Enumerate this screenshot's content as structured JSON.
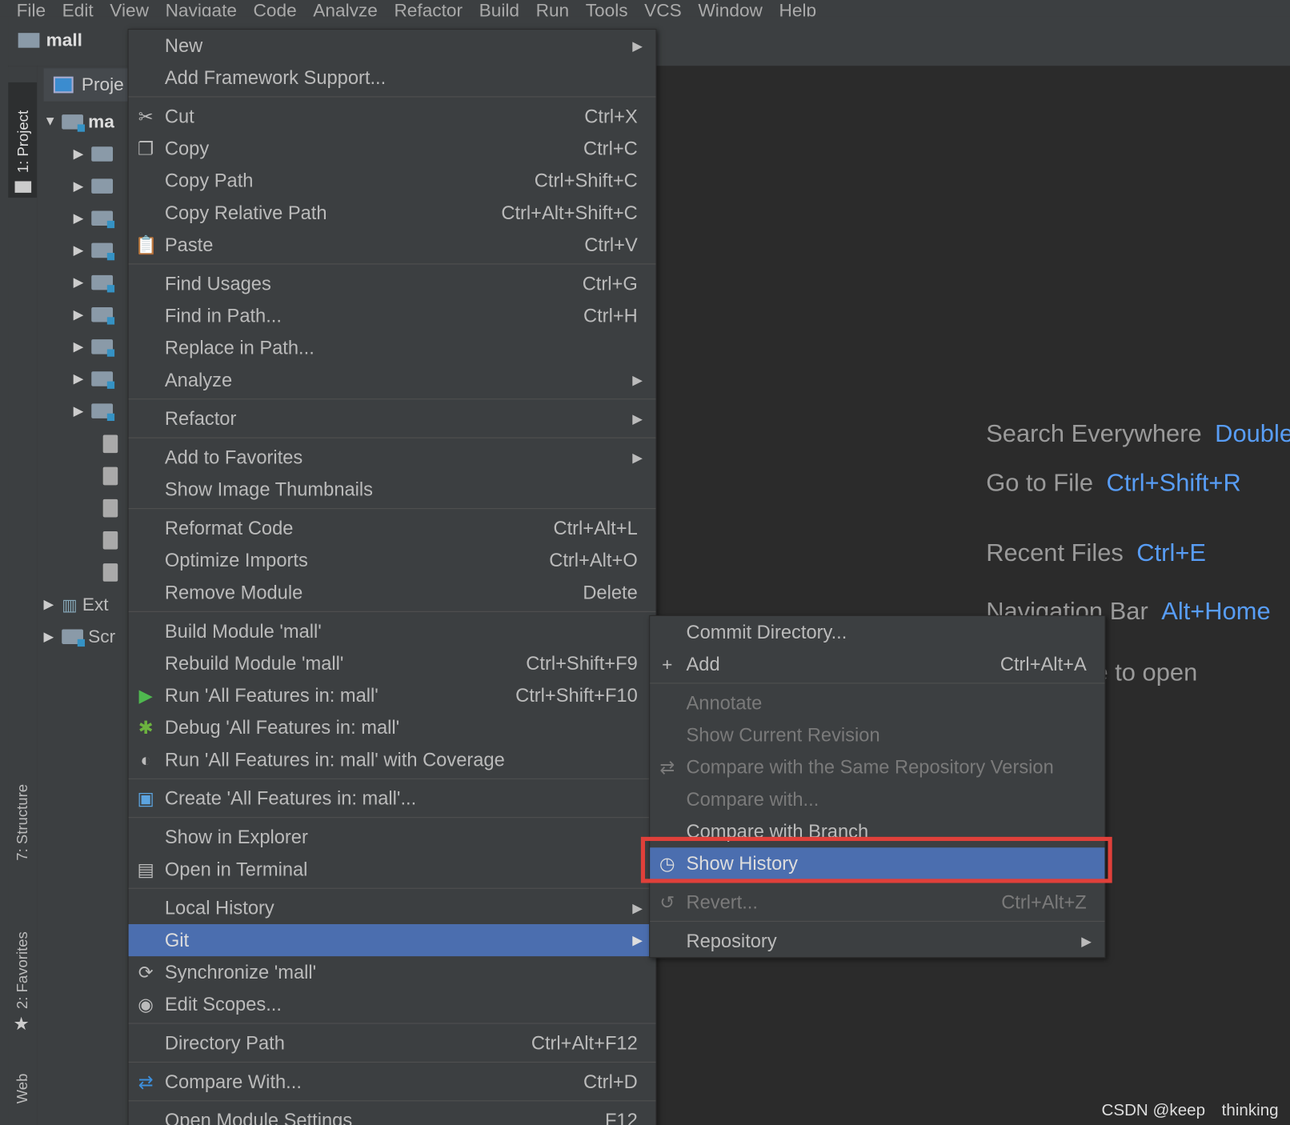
{
  "menubar": [
    "File",
    "Edit",
    "View",
    "Navigate",
    "Code",
    "Analyze",
    "Refactor",
    "Build",
    "Run",
    "Tools",
    "VCS",
    "Window",
    "Help"
  ],
  "navbar": {
    "project": "mall"
  },
  "tool_windows": {
    "project": "1: Project",
    "structure": "7: Structure",
    "favorites": "2: Favorites",
    "web": "Web"
  },
  "project_panel": {
    "tab": "Proje",
    "root": "ma",
    "ext": "Ext",
    "scr": "Scr"
  },
  "context_menu": [
    {
      "label": "New",
      "submenu": true
    },
    {
      "label": "Add Framework Support..."
    },
    {
      "sep": true
    },
    {
      "label": "Cut",
      "shortcut": "Ctrl+X",
      "icon": "scissors-icon"
    },
    {
      "label": "Copy",
      "shortcut": "Ctrl+C",
      "icon": "copy-icon"
    },
    {
      "label": "Copy Path",
      "shortcut": "Ctrl+Shift+C"
    },
    {
      "label": "Copy Relative Path",
      "shortcut": "Ctrl+Alt+Shift+C"
    },
    {
      "label": "Paste",
      "shortcut": "Ctrl+V",
      "icon": "paste-icon"
    },
    {
      "sep": true
    },
    {
      "label": "Find Usages",
      "shortcut": "Ctrl+G"
    },
    {
      "label": "Find in Path...",
      "shortcut": "Ctrl+H"
    },
    {
      "label": "Replace in Path..."
    },
    {
      "label": "Analyze",
      "submenu": true
    },
    {
      "sep": true
    },
    {
      "label": "Refactor",
      "submenu": true
    },
    {
      "sep": true
    },
    {
      "label": "Add to Favorites",
      "submenu": true
    },
    {
      "label": "Show Image Thumbnails"
    },
    {
      "sep": true
    },
    {
      "label": "Reformat Code",
      "shortcut": "Ctrl+Alt+L"
    },
    {
      "label": "Optimize Imports",
      "shortcut": "Ctrl+Alt+O"
    },
    {
      "label": "Remove Module",
      "shortcut": "Delete"
    },
    {
      "sep": true
    },
    {
      "label": "Build Module 'mall'"
    },
    {
      "label": "Rebuild Module 'mall'",
      "shortcut": "Ctrl+Shift+F9"
    },
    {
      "label": "Run 'All Features in: mall'",
      "shortcut": "Ctrl+Shift+F10",
      "icon": "run-icon"
    },
    {
      "label": "Debug 'All Features in: mall'",
      "icon": "debug-icon"
    },
    {
      "label": "Run 'All Features in: mall' with Coverage",
      "icon": "coverage-icon"
    },
    {
      "sep": true
    },
    {
      "label": "Create 'All Features in: mall'...",
      "icon": "create-config-icon"
    },
    {
      "sep": true
    },
    {
      "label": "Show in Explorer"
    },
    {
      "label": "Open in Terminal",
      "icon": "terminal-icon"
    },
    {
      "sep": true
    },
    {
      "label": "Local History",
      "submenu": true
    },
    {
      "label": "Git",
      "submenu": true,
      "highlighted": true
    },
    {
      "label": "Synchronize 'mall'",
      "icon": "sync-icon"
    },
    {
      "label": "Edit Scopes...",
      "icon": "scopes-icon"
    },
    {
      "sep": true
    },
    {
      "label": "Directory Path",
      "shortcut": "Ctrl+Alt+F12"
    },
    {
      "sep": true
    },
    {
      "label": "Compare With...",
      "shortcut": "Ctrl+D",
      "icon": "compare-icon"
    },
    {
      "sep": true
    },
    {
      "label": "Open Module Settings",
      "shortcut": "F12"
    }
  ],
  "git_submenu": [
    {
      "label": "Commit Directory..."
    },
    {
      "label": "Add",
      "shortcut": "Ctrl+Alt+A",
      "icon": "plus-icon"
    },
    {
      "sep": true
    },
    {
      "label": "Annotate",
      "disabled": true
    },
    {
      "label": "Show Current Revision",
      "disabled": true
    },
    {
      "label": "Compare with the Same Repository Version",
      "disabled": true,
      "icon": "compare-icon"
    },
    {
      "label": "Compare with...",
      "disabled": true
    },
    {
      "label": "Compare with Branch"
    },
    {
      "label": "Show History",
      "highlighted": true,
      "icon": "clock-icon"
    },
    {
      "sep": true
    },
    {
      "label": "Revert...",
      "shortcut": "Ctrl+Alt+Z",
      "disabled": true,
      "icon": "revert-icon"
    },
    {
      "sep": true
    },
    {
      "label": "Repository",
      "submenu": true
    }
  ],
  "editor_hints": [
    {
      "label": "Search Everywhere",
      "key": "Double Shift"
    },
    {
      "label": "Go to File",
      "key": "Ctrl+Shift+R"
    },
    {
      "label": "Recent Files",
      "key": "Ctrl+E"
    },
    {
      "label": "Navigation Bar",
      "key": "Alt+Home"
    },
    {
      "label": "Drop files here to open",
      "key": ""
    }
  ],
  "watermark": "CSDN @keep　thinking",
  "colors": {
    "menu_bg": "#3c3f41",
    "highlight": "#4b6eaf",
    "shortcut_blue": "#589df6",
    "callout_red": "#e0403a",
    "editor_bg": "#2b2b2b"
  }
}
